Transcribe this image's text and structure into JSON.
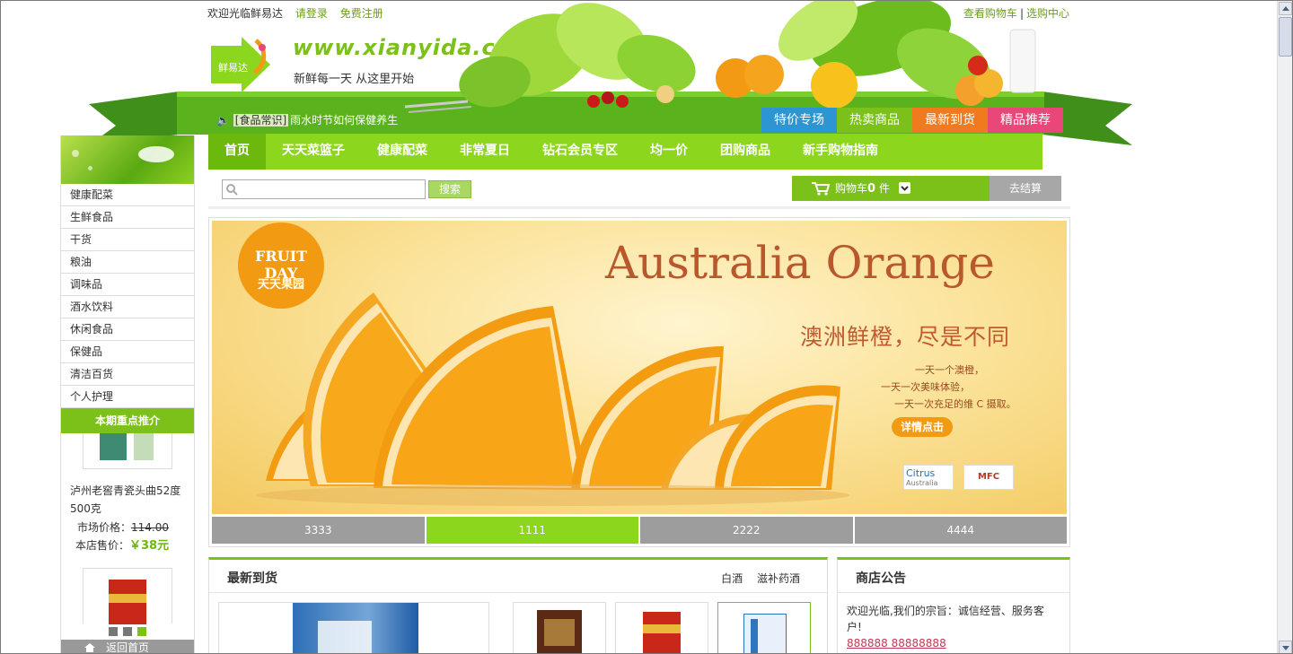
{
  "topbar": {
    "welcome": "欢迎光临鲜易达",
    "login": "请登录",
    "register": "免费注册",
    "view_cart": "查看购物车",
    "separator": "|",
    "shopping_center": "选购中心"
  },
  "header": {
    "logo_text": "鲜易达",
    "site_url": "www.xianyida.com",
    "slogan": "新鲜每一天 从这里开始",
    "notice_tag": "[食品常识]",
    "notice_text": "雨水时节如何保健养生"
  },
  "promo_tabs": [
    {
      "label": "特价专场",
      "color": "#2d95d2"
    },
    {
      "label": "热卖商品",
      "color": "#7bc11a"
    },
    {
      "label": "最新到货",
      "color": "#f07b1f"
    },
    {
      "label": "精品推荐",
      "color": "#e9477a"
    }
  ],
  "main_nav": [
    "首页",
    "天天菜篮子",
    "健康配菜",
    "非常夏日",
    "钻石会员专区",
    "均一价",
    "团购商品",
    "新手购物指南"
  ],
  "sidebar": {
    "categories": [
      "健康配菜",
      "生鲜食品",
      "干货",
      "粮油",
      "调味品",
      "酒水饮料",
      "休闲食品",
      "保健品",
      "清洁百货",
      "个人护理"
    ],
    "featured_title": "本期重点推介",
    "featured_product": {
      "name": "泸州老窖青瓷头曲52度500克",
      "market_label": "市场价格：",
      "market_price": "114.00",
      "store_label": "本店售价：",
      "store_price": "￥38元"
    },
    "back_home": "返回首页"
  },
  "search": {
    "placeholder": "",
    "button": "搜索"
  },
  "cart": {
    "label": "购物车",
    "count": "0",
    "unit": "件",
    "checkout": "去结算"
  },
  "banner": {
    "logo_top": "FRUIT DAY",
    "logo_bottom": "天天果园",
    "title": "Australia Orange",
    "subtitle": "澳洲鲜橙，尽是不同",
    "line1": "一天一个澳橙，",
    "line2": "一天一次美味体验，",
    "line3": "一天一次充足的维 C 摄取。",
    "cta": "详情点击",
    "badge1": "Citrus",
    "badge1_sub": "Australia",
    "badge2": "MFC"
  },
  "slide_tabs": [
    "3333",
    "1111",
    "2222",
    "4444"
  ],
  "arrivals": {
    "title": "最新到货",
    "links": [
      "白酒",
      "滋补药酒"
    ]
  },
  "notice_board": {
    "title": "商店公告",
    "text": "欢迎光临,我们的宗旨：诚信经营、服务客户!",
    "phone": "888888 88888888"
  },
  "colors": {
    "brand_green": "#7bc11a",
    "nav_green": "#8dd61e",
    "nav_active": "#6cb80d"
  }
}
